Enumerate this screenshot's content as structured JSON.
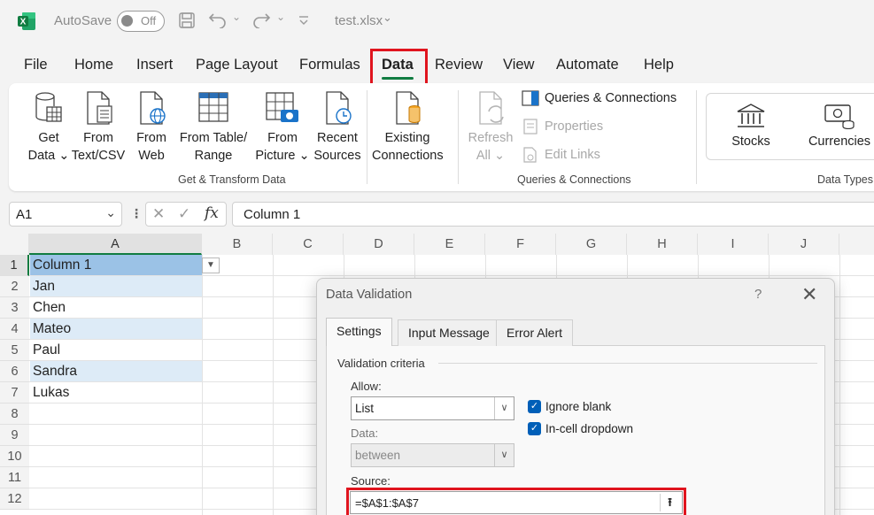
{
  "titlebar": {
    "autosave_label": "AutoSave",
    "toggle_state": "Off",
    "filename": "test.xlsx",
    "filename_chevron": "⌄"
  },
  "menu": {
    "tabs": [
      "File",
      "Home",
      "Insert",
      "Page Layout",
      "Formulas",
      "Data",
      "Review",
      "View",
      "Automate",
      "Help"
    ],
    "active": "Data"
  },
  "ribbon": {
    "get_transform": {
      "group_label": "Get & Transform Data",
      "buttons": [
        {
          "line1": "Get",
          "line2": "Data ⌄",
          "icon": "database-table-icon"
        },
        {
          "line1": "From",
          "line2": "Text/CSV",
          "icon": "text-file-icon"
        },
        {
          "line1": "From",
          "line2": "Web",
          "icon": "web-file-icon"
        },
        {
          "line1": "From Table/",
          "line2": "Range",
          "icon": "table-icon"
        },
        {
          "line1": "From",
          "line2": "Picture ⌄",
          "icon": "picture-table-icon"
        },
        {
          "line1": "Recent",
          "line2": "Sources",
          "icon": "recent-file-icon"
        },
        {
          "line1": "Existing",
          "line2": "Connections",
          "icon": "connections-file-icon"
        }
      ]
    },
    "queries": {
      "group_label": "Queries & Connections",
      "refresh_line1": "Refresh",
      "refresh_line2": "All ⌄",
      "queries_connections": "Queries & Connections",
      "properties": "Properties",
      "edit_links": "Edit Links"
    },
    "data_types": {
      "group_label": "Data Types",
      "stocks": "Stocks",
      "currencies": "Currencies"
    }
  },
  "formula_bar": {
    "name_box": "A1",
    "cancel_glyph": "✕",
    "enter_glyph": "✓",
    "fx_label": "fx",
    "formula": "Column 1"
  },
  "grid": {
    "columns": [
      "A",
      "B",
      "C",
      "D",
      "E",
      "F",
      "G",
      "H",
      "I",
      "J"
    ],
    "rows": [
      "1",
      "2",
      "3",
      "4",
      "5",
      "6",
      "7",
      "8",
      "9",
      "10",
      "11",
      "12"
    ],
    "cells_a": [
      "Column 1",
      "Jan",
      "Chen",
      "Mateo",
      "Paul",
      "Sandra",
      "Lukas"
    ]
  },
  "dialog": {
    "title": "Data Validation",
    "help": "?",
    "close": "✕",
    "tabs": [
      "Settings",
      "Input Message",
      "Error Alert"
    ],
    "active_tab": "Settings",
    "criteria_label": "Validation criteria",
    "allow_label": "Allow:",
    "allow_value": "List",
    "data_label": "Data:",
    "data_value": "between",
    "ignore_blank": "Ignore blank",
    "in_cell_dropdown": "In-cell dropdown",
    "ignore_blank_checked": true,
    "in_cell_checked": true,
    "source_label": "Source:",
    "source_value": "=$A$1:$A$7"
  },
  "colors": {
    "excel_green": "#107c41",
    "highlight_red": "#e0141e",
    "table_header": "#9bc2e6",
    "table_band": "#ddebf7",
    "checkbox_blue": "#005fb8"
  }
}
